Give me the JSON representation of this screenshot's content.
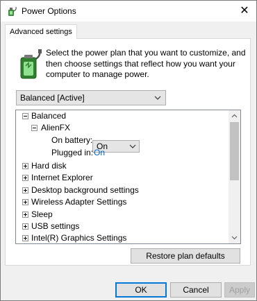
{
  "window": {
    "title": "Power Options",
    "close_glyph": "✕",
    "icon": "power-options-icon"
  },
  "tab": {
    "label": "Advanced settings"
  },
  "intro": {
    "text": "Select the power plan that you want to customize, and then choose settings that reflect how you want your computer to manage power."
  },
  "plan_select": {
    "value": "Balanced [Active]"
  },
  "tree": {
    "balanced": "Balanced",
    "alienfx": "AlienFX",
    "on_battery_label": "On battery:",
    "on_battery_value": "On",
    "plugged_in_label": "Plugged in:",
    "plugged_in_value": "On",
    "items": [
      "Hard disk",
      "Internet Explorer",
      "Desktop background settings",
      "Wireless Adapter Settings",
      "Sleep",
      "USB settings",
      "Intel(R) Graphics Settings"
    ]
  },
  "buttons": {
    "restore": "Restore plan defaults",
    "ok": "OK",
    "cancel": "Cancel",
    "apply": "Apply"
  },
  "colors": {
    "link_value": "#0066cc",
    "focus_border": "#0078d7"
  }
}
